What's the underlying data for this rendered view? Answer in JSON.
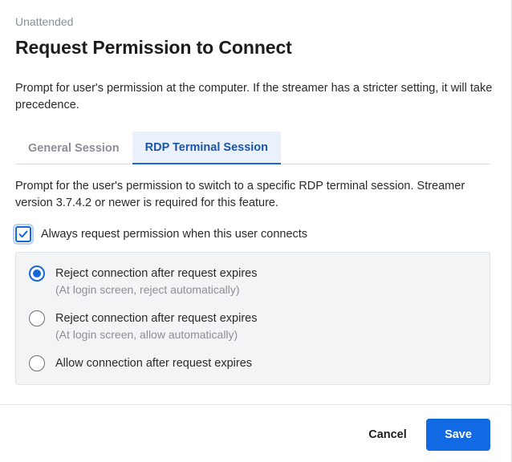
{
  "dialog": {
    "eyebrow": "Unattended",
    "title": "Request Permission to Connect",
    "description": "Prompt for user's permission at the computer. If the streamer has a stricter setting, it will take precedence."
  },
  "tabs": [
    {
      "label": "General Session",
      "active": false
    },
    {
      "label": "RDP Terminal Session",
      "active": true
    }
  ],
  "tab_content": {
    "description": "Prompt for the user's permission to switch to a specific RDP terminal session. Streamer version 3.7.4.2 or newer is required for this feature.",
    "checkbox": {
      "label": "Always request permission when this user connects",
      "checked": true
    },
    "options": [
      {
        "label": "Reject connection after request expires",
        "sublabel": "(At login screen, reject automatically)",
        "selected": true
      },
      {
        "label": "Reject connection after request expires",
        "sublabel": "(At login screen, allow automatically)",
        "selected": false
      },
      {
        "label": "Allow connection after request expires",
        "sublabel": "",
        "selected": false
      }
    ]
  },
  "footer": {
    "cancel_label": "Cancel",
    "save_label": "Save"
  },
  "colors": {
    "accent": "#1169e3",
    "active_tab_text": "#1b55a8",
    "muted_text": "#8a8f98"
  },
  "icons": {
    "checkbox_check": "checkmark-icon"
  }
}
